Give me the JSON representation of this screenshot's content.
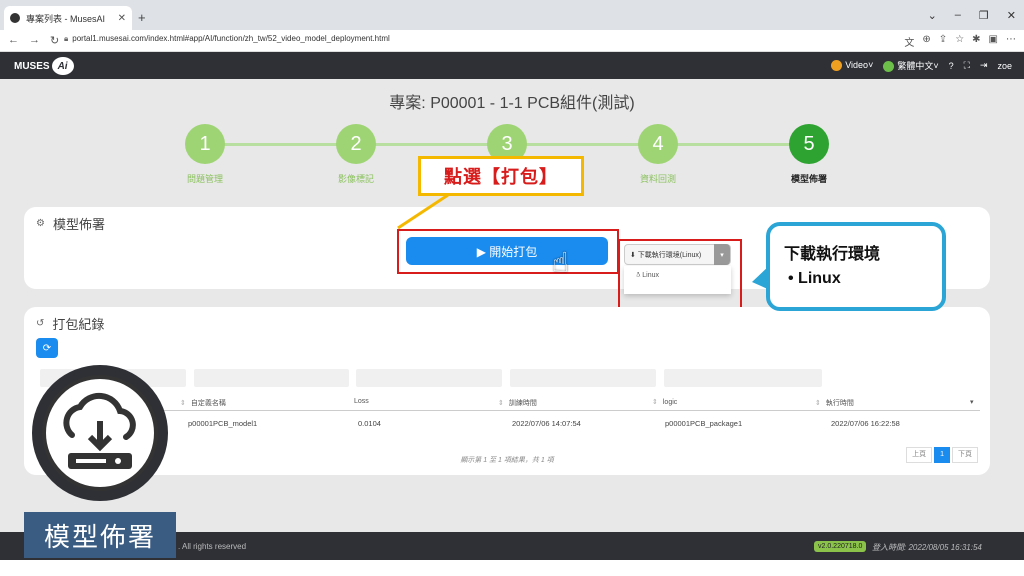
{
  "browser": {
    "tab_title": "專案列表 - MusesAI",
    "tab_close": "✕",
    "new_tab": "+",
    "url": "portal1.musesai.com/index.html#app/AI/function/zh_tw/52_video_model_deployment.html",
    "window_controls": [
      "⌄",
      "–",
      "❐",
      "✕"
    ]
  },
  "header": {
    "logo_text": "MUSES",
    "logo_ai": "Ai",
    "video_label": "Video",
    "lang_label": "繁體中文",
    "user": "zoe"
  },
  "project_title": "專案: P00001 - 1-1 PCB組件(測試)",
  "steps": [
    {
      "num": "1",
      "label": "問題管理"
    },
    {
      "num": "2",
      "label": "影像標記"
    },
    {
      "num": "3",
      "label": ""
    },
    {
      "num": "4",
      "label": "資料回測"
    },
    {
      "num": "5",
      "label": "模型佈署"
    }
  ],
  "deploy_card": {
    "title": "模型佈署",
    "start_button": "▶ 開始打包",
    "download_button": "⬇ 下載執行環境(Linux)",
    "download_option": "Linux"
  },
  "records_card": {
    "title": "打包紀錄",
    "columns": [
      "自定義名稱",
      "Loss",
      "訓練時間",
      "logic",
      "執行時間"
    ],
    "rows": [
      [
        "p00001PCB_model1",
        "0.0104",
        "2022/07/06 14:07:54",
        "p00001PCB_package1",
        "2022/07/06 16:22:58"
      ]
    ],
    "page_info": "顯示第 1 至 1 項結果，共 1 項",
    "pager": [
      "上頁",
      "1",
      "下頁"
    ]
  },
  "footer": {
    "rights": ". All rights reserved",
    "version": "v2.0.220718.0",
    "login_time": "登入時間: 2022/08/05 16:31:54"
  },
  "annotations": {
    "click_label": "點選【打包】",
    "bubble_title": "下載執行環境",
    "bubble_item": "• Linux",
    "deploy_label": "模型佈署"
  }
}
